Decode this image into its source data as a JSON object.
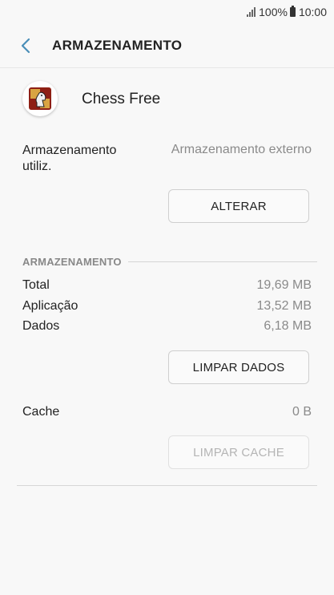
{
  "status_bar": {
    "battery": "100%",
    "time": "10:00"
  },
  "header": {
    "title": "ARMAZENAMENTO"
  },
  "app": {
    "name": "Chess Free"
  },
  "storage_used": {
    "label": "Armazenamento utiliz.",
    "value": "Armazenamento externo",
    "button": "ALTERAR"
  },
  "storage_section": {
    "title": "ARMAZENAMENTO",
    "rows": [
      {
        "label": "Total",
        "value": "19,69 MB"
      },
      {
        "label": "Aplicação",
        "value": "13,52 MB"
      },
      {
        "label": "Dados",
        "value": "6,18 MB"
      }
    ],
    "clear_data_button": "LIMPAR DADOS"
  },
  "cache": {
    "label": "Cache",
    "value": "0 B",
    "button": "LIMPAR CACHE"
  },
  "colors": {
    "accent": "#4a8fb8",
    "muted": "#8a8a8a"
  }
}
